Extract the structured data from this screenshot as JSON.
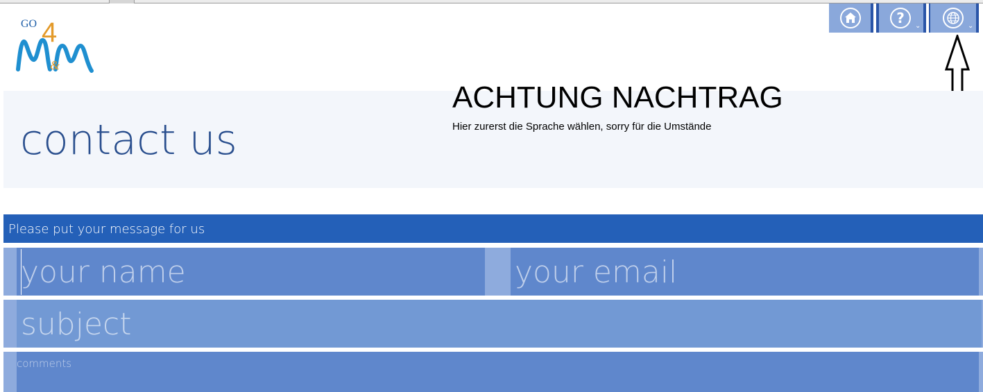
{
  "logo": {
    "text_top": "GO",
    "text_mid": "4",
    "text_bottom": "M M",
    "text_amp": "&"
  },
  "nav": {
    "home_icon": "home-icon",
    "help_icon": "help-icon",
    "help_glyph": "?",
    "language_icon": "globe-icon",
    "caret": "⌄",
    "button_color": "#8aa8db",
    "divider_color": "#2a55a8"
  },
  "header": {
    "title": "contact us",
    "title_color": "#2a4f8e",
    "background": "#f3f6fb"
  },
  "notice": {
    "title": "ACHTUNG NACHTRAG",
    "text": "Hier zurerst die Sprache wählen, sorry für die Umstände"
  },
  "form": {
    "heading": "Please put your message for us",
    "heading_color": "#2460b8",
    "name": {
      "placeholder": "your name",
      "value": ""
    },
    "email": {
      "placeholder": "your email",
      "value": ""
    },
    "subject": {
      "placeholder": "subject",
      "value": ""
    },
    "comments": {
      "placeholder": "comments",
      "value": ""
    }
  }
}
